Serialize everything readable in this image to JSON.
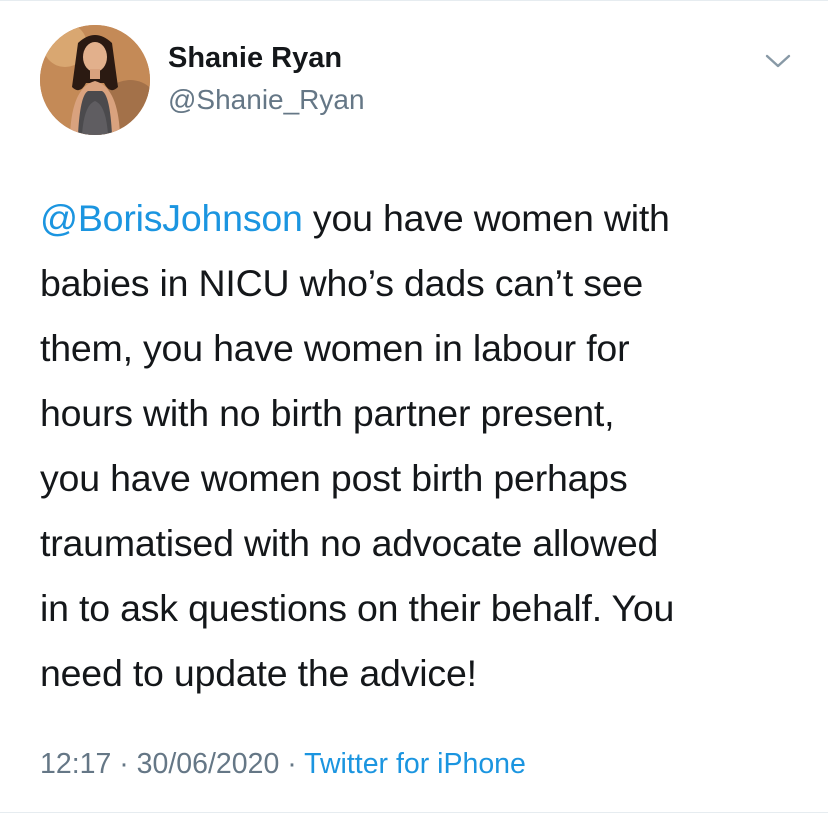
{
  "tweet": {
    "author": {
      "name": "Shanie Ryan",
      "handle": "@Shanie_Ryan"
    },
    "mention": "@BorisJohnson",
    "lines": [
      " you have women with",
      "babies in NICU who’s dads can’t see",
      "them, you have women in labour for",
      "hours with no birth partner present,",
      "you have women post birth perhaps",
      "traumatised with no advocate allowed",
      "in to ask questions on their behalf. You",
      "need to update the advice!"
    ],
    "time": "12:17",
    "separator": " · ",
    "date": "30/06/2020",
    "source": "Twitter for iPhone"
  },
  "icons": {
    "menu": "chevron-down-icon"
  },
  "colors": {
    "link": "#1b95e0",
    "text": "#14171a",
    "muted": "#657786"
  }
}
